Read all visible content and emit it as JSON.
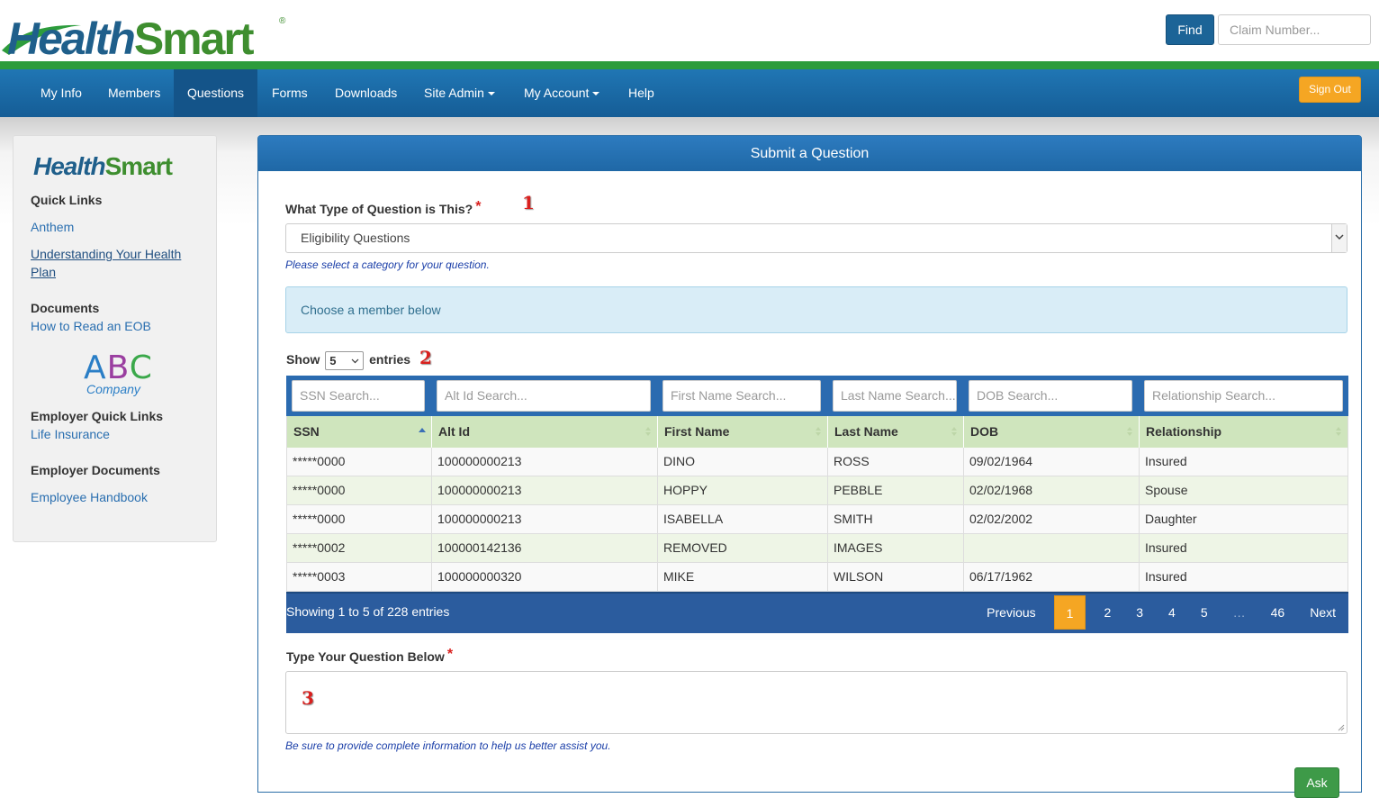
{
  "brand": {
    "name_part1": "Health",
    "name_part2": "Smart",
    "registered": "®"
  },
  "header": {
    "find_label": "Find",
    "claim_placeholder": "Claim Number..."
  },
  "nav": {
    "items": [
      {
        "label": "My Info"
      },
      {
        "label": "Members"
      },
      {
        "label": "Questions",
        "active": true
      },
      {
        "label": "Forms"
      },
      {
        "label": "Downloads"
      },
      {
        "label": "Site Admin",
        "dropdown": true
      },
      {
        "label": "My Account",
        "dropdown": true
      },
      {
        "label": "Help"
      }
    ],
    "signout_label": "Sign Out"
  },
  "sidebar": {
    "quick_links_heading": "Quick Links",
    "quick_links": [
      "Anthem",
      "Understanding Your Health Plan"
    ],
    "documents_heading": "Documents",
    "documents": [
      "How to Read an EOB"
    ],
    "employer_logo": {
      "letters": "ABC",
      "company": "Company"
    },
    "employer_quick_links_heading": "Employer Quick Links",
    "employer_quick_links": [
      "Life Insurance"
    ],
    "employer_documents_heading": "Employer Documents",
    "employer_documents": [
      "Employee Handbook"
    ]
  },
  "panel": {
    "title": "Submit a Question",
    "question_type_label": "What Type of Question is This?",
    "required_mark": "*",
    "question_type_value": "Eligibility Questions",
    "question_type_help": "Please select a category for your question.",
    "alert_text": "Choose a member below",
    "annotations": [
      "1",
      "2",
      "3"
    ],
    "show_label": "Show",
    "entries_label": "entries",
    "page_length": "5",
    "question_label": "Type Your Question Below",
    "question_help": "Be sure to provide complete information to help us better assist you.",
    "ask_label": "Ask"
  },
  "table": {
    "search_placeholders": [
      "SSN Search...",
      "Alt Id Search...",
      "First Name Search...",
      "Last Name Search...",
      "DOB Search...",
      "Relationship Search..."
    ],
    "columns": [
      "SSN",
      "Alt Id",
      "First Name",
      "Last Name",
      "DOB",
      "Relationship"
    ],
    "sorted_column": "SSN",
    "sort_direction": "ascending",
    "rows": [
      [
        "*****0000",
        "100000000213",
        "DINO",
        "ROSS",
        "09/02/1964",
        "Insured"
      ],
      [
        "*****0000",
        "100000000213",
        "HOPPY",
        "PEBBLE",
        "02/02/1968",
        "Spouse"
      ],
      [
        "*****0000",
        "100000000213",
        "ISABELLA",
        "SMITH",
        "02/02/2002",
        "Daughter"
      ],
      [
        "*****0002",
        "100000142136",
        "REMOVED",
        "IMAGES",
        "",
        "Insured"
      ],
      [
        "*****0003",
        "100000000320",
        "MIKE",
        "WILSON",
        "06/17/1962",
        "Insured"
      ]
    ],
    "info": "Showing 1 to 5 of 228 entries",
    "pager": {
      "previous": "Previous",
      "pages": [
        "1",
        "2",
        "3",
        "4",
        "5",
        "…",
        "46"
      ],
      "current": "1",
      "next": "Next"
    }
  },
  "colors": {
    "nav_blue": "#1e6aa8",
    "green_bar": "#2d9c3c",
    "accent_orange": "#f5a623",
    "required_red": "#d9201e"
  }
}
